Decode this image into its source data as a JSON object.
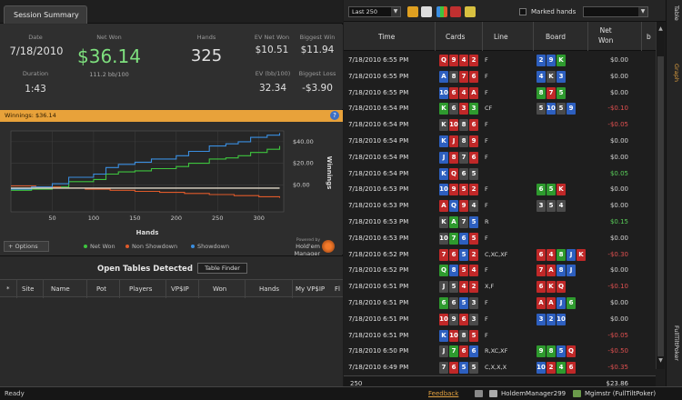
{
  "left": {
    "tab": "Session Summary",
    "stats": {
      "date_label": "Date",
      "date": "7/18/2010",
      "netwon_label": "Net Won",
      "netwon": "$36.14",
      "netwon_sub": "111.2 bb/100",
      "hands_label": "Hands",
      "hands": "325",
      "ev_netwon_label": "EV Net Won",
      "ev_netwon": "$10.51",
      "biggest_win_label": "Biggest Win",
      "biggest_win": "$11.94",
      "duration_label": "Duration",
      "duration": "1:43",
      "ev_bb_label": "EV (bb/100)",
      "ev_bb": "32.34",
      "biggest_loss_label": "Biggest Loss",
      "biggest_loss": "-$3.90"
    },
    "winnings_bar": "Winnings: $36.14",
    "options_label": "+ Options",
    "legend": [
      {
        "label": "Net Won",
        "color": "#3ec43e"
      },
      {
        "label": "Non Showdown",
        "color": "#e05a2a"
      },
      {
        "label": "Showdown",
        "color": "#3a8ee0"
      }
    ],
    "powered_by": "Powered by",
    "brand": "Hold'em Manager",
    "open_tables": {
      "title": "Open Tables Detected",
      "finder_button": "Table Finder",
      "columns": [
        "Site",
        "Name",
        "Pot",
        "Players",
        "VP$IP",
        "Won",
        "Hands",
        "My VP$IP",
        "Fl"
      ]
    }
  },
  "chart_data": {
    "type": "line",
    "xlabel": "Hands",
    "ylabel": "Winnings",
    "xticks": [
      "50",
      "100",
      "150",
      "200",
      "250",
      "300"
    ],
    "yticks": [
      "$40.00",
      "$20.00",
      "$0.00"
    ],
    "xlim": [
      0,
      330
    ],
    "ylim": [
      -25,
      50
    ],
    "series": [
      {
        "name": "Net Won",
        "color": "#3ec43e",
        "x": [
          0,
          25,
          50,
          70,
          100,
          115,
          130,
          150,
          170,
          200,
          215,
          240,
          260,
          275,
          290,
          310,
          325
        ],
        "y": [
          -5,
          -4,
          -2,
          3,
          5,
          10,
          12,
          13,
          15,
          17,
          20,
          24,
          25,
          27,
          30,
          33,
          36
        ]
      },
      {
        "name": "Non Showdown",
        "color": "#e05a2a",
        "x": [
          0,
          30,
          60,
          90,
          120,
          150,
          180,
          210,
          240,
          270,
          300,
          325
        ],
        "y": [
          -1,
          -2,
          -3,
          -4,
          -5,
          -6,
          -7,
          -8,
          -9,
          -10,
          -11,
          -12
        ]
      },
      {
        "name": "Showdown",
        "color": "#3a8ee0",
        "x": [
          0,
          25,
          50,
          70,
          100,
          115,
          130,
          150,
          170,
          200,
          215,
          240,
          260,
          275,
          290,
          310,
          325
        ],
        "y": [
          -4,
          -2,
          1,
          7,
          10,
          16,
          19,
          21,
          24,
          27,
          31,
          36,
          38,
          40,
          44,
          46,
          48
        ]
      },
      {
        "name": "EV",
        "color": "#e0d8c8",
        "x": [
          0,
          325
        ],
        "y": [
          -3,
          -3
        ]
      }
    ]
  },
  "right": {
    "last_select": "Last 250",
    "marked_hands": "Marked hands",
    "columns": [
      "Time",
      "Cards",
      "Line",
      "Board",
      "Net\nWon",
      "b"
    ],
    "rows": [
      {
        "time": "7/18/2010 6:55 PM",
        "cards": [
          [
            "Q",
            "h"
          ],
          [
            "9",
            "h"
          ],
          [
            "4",
            "h"
          ],
          [
            "2",
            "h"
          ]
        ],
        "line": "F",
        "board": [
          [
            "2",
            "d"
          ],
          [
            "9",
            "d"
          ],
          [
            "K",
            "c"
          ]
        ],
        "won": "$0.00"
      },
      {
        "time": "7/18/2010 6:55 PM",
        "cards": [
          [
            "A",
            "d"
          ],
          [
            "8",
            "s"
          ],
          [
            "7",
            "h"
          ],
          [
            "6",
            "h"
          ]
        ],
        "line": "F",
        "board": [
          [
            "4",
            "d"
          ],
          [
            "K",
            "s"
          ],
          [
            "3",
            "d"
          ]
        ],
        "won": "$0.00"
      },
      {
        "time": "7/18/2010 6:55 PM",
        "cards": [
          [
            "10",
            "d"
          ],
          [
            "6",
            "h"
          ],
          [
            "4",
            "h"
          ],
          [
            "A",
            "h"
          ]
        ],
        "line": "F",
        "board": [
          [
            "8",
            "c"
          ],
          [
            "7",
            "h"
          ],
          [
            "5",
            "c"
          ]
        ],
        "won": "$0.00"
      },
      {
        "time": "7/18/2010 6:54 PM",
        "cards": [
          [
            "K",
            "c"
          ],
          [
            "6",
            "s"
          ],
          [
            "3",
            "h"
          ],
          [
            "3",
            "c"
          ]
        ],
        "line": "CF",
        "board": [
          [
            "5",
            "s"
          ],
          [
            "10",
            "d"
          ],
          [
            "5",
            "s"
          ],
          [
            "9",
            "d"
          ]
        ],
        "won": "-$0.10"
      },
      {
        "time": "7/18/2010 6:54 PM",
        "cards": [
          [
            "K",
            "s"
          ],
          [
            "10",
            "h"
          ],
          [
            "8",
            "s"
          ],
          [
            "6",
            "h"
          ]
        ],
        "line": "F",
        "board": [],
        "won": "-$0.05"
      },
      {
        "time": "7/18/2010 6:54 PM",
        "cards": [
          [
            "K",
            "d"
          ],
          [
            "J",
            "h"
          ],
          [
            "8",
            "s"
          ],
          [
            "9",
            "h"
          ]
        ],
        "line": "F",
        "board": [],
        "won": "$0.00"
      },
      {
        "time": "7/18/2010 6:54 PM",
        "cards": [
          [
            "J",
            "d"
          ],
          [
            "8",
            "h"
          ],
          [
            "7",
            "s"
          ],
          [
            "6",
            "h"
          ]
        ],
        "line": "F",
        "board": [],
        "won": "$0.00"
      },
      {
        "time": "7/18/2010 6:54 PM",
        "cards": [
          [
            "K",
            "d"
          ],
          [
            "Q",
            "h"
          ],
          [
            "6",
            "s"
          ],
          [
            "5",
            "s"
          ]
        ],
        "line": "",
        "board": [],
        "won": "$0.05"
      },
      {
        "time": "7/18/2010 6:53 PM",
        "cards": [
          [
            "10",
            "d"
          ],
          [
            "9",
            "h"
          ],
          [
            "5",
            "h"
          ],
          [
            "2",
            "h"
          ]
        ],
        "line": "F",
        "board": [
          [
            "6",
            "c"
          ],
          [
            "5",
            "c"
          ],
          [
            "K",
            "h"
          ]
        ],
        "won": "$0.00"
      },
      {
        "time": "7/18/2010 6:53 PM",
        "cards": [
          [
            "A",
            "h"
          ],
          [
            "Q",
            "d"
          ],
          [
            "9",
            "h"
          ],
          [
            "4",
            "s"
          ]
        ],
        "line": "F",
        "board": [
          [
            "3",
            "s"
          ],
          [
            "5",
            "s"
          ],
          [
            "4",
            "s"
          ]
        ],
        "won": "$0.00"
      },
      {
        "time": "7/18/2010 6:53 PM",
        "cards": [
          [
            "K",
            "s"
          ],
          [
            "A",
            "c"
          ],
          [
            "7",
            "s"
          ],
          [
            "5",
            "d"
          ]
        ],
        "line": "R",
        "board": [],
        "won": "$0.15"
      },
      {
        "time": "7/18/2010 6:53 PM",
        "cards": [
          [
            "10",
            "s"
          ],
          [
            "7",
            "c"
          ],
          [
            "6",
            "d"
          ],
          [
            "5",
            "h"
          ]
        ],
        "line": "F",
        "board": [],
        "won": "$0.00"
      },
      {
        "time": "7/18/2010 6:52 PM",
        "cards": [
          [
            "7",
            "h"
          ],
          [
            "6",
            "h"
          ],
          [
            "5",
            "d"
          ],
          [
            "2",
            "h"
          ]
        ],
        "line": "C,XC,XF",
        "board": [
          [
            "6",
            "h"
          ],
          [
            "4",
            "h"
          ],
          [
            "8",
            "c"
          ],
          [
            "J",
            "d"
          ],
          [
            "K",
            "h"
          ]
        ],
        "won": "-$0.30"
      },
      {
        "time": "7/18/2010 6:52 PM",
        "cards": [
          [
            "Q",
            "c"
          ],
          [
            "8",
            "d"
          ],
          [
            "5",
            "h"
          ],
          [
            "4",
            "h"
          ]
        ],
        "line": "F",
        "board": [
          [
            "7",
            "h"
          ],
          [
            "A",
            "h"
          ],
          [
            "8",
            "d"
          ],
          [
            "J",
            "d"
          ]
        ],
        "won": "$0.00"
      },
      {
        "time": "7/18/2010 6:51 PM",
        "cards": [
          [
            "J",
            "s"
          ],
          [
            "5",
            "s"
          ],
          [
            "4",
            "h"
          ],
          [
            "2",
            "h"
          ]
        ],
        "line": "X,F",
        "board": [
          [
            "6",
            "h"
          ],
          [
            "K",
            "h"
          ],
          [
            "Q",
            "h"
          ]
        ],
        "won": "-$0.10"
      },
      {
        "time": "7/18/2010 6:51 PM",
        "cards": [
          [
            "6",
            "c"
          ],
          [
            "6",
            "s"
          ],
          [
            "5",
            "d"
          ],
          [
            "3",
            "s"
          ]
        ],
        "line": "F",
        "board": [
          [
            "A",
            "h"
          ],
          [
            "A",
            "h"
          ],
          [
            "J",
            "d"
          ],
          [
            "6",
            "c"
          ]
        ],
        "won": "$0.00"
      },
      {
        "time": "7/18/2010 6:51 PM",
        "cards": [
          [
            "10",
            "h"
          ],
          [
            "9",
            "s"
          ],
          [
            "6",
            "h"
          ],
          [
            "3",
            "s"
          ]
        ],
        "line": "F",
        "board": [
          [
            "3",
            "d"
          ],
          [
            "2",
            "d"
          ],
          [
            "10",
            "d"
          ]
        ],
        "won": "$0.00"
      },
      {
        "time": "7/18/2010 6:51 PM",
        "cards": [
          [
            "K",
            "d"
          ],
          [
            "10",
            "h"
          ],
          [
            "8",
            "s"
          ],
          [
            "5",
            "h"
          ]
        ],
        "line": "F",
        "board": [],
        "won": "-$0.05"
      },
      {
        "time": "7/18/2010 6:50 PM",
        "cards": [
          [
            "J",
            "s"
          ],
          [
            "7",
            "c"
          ],
          [
            "6",
            "h"
          ],
          [
            "6",
            "d"
          ]
        ],
        "line": "R,XC,XF",
        "board": [
          [
            "9",
            "c"
          ],
          [
            "8",
            "c"
          ],
          [
            "5",
            "d"
          ],
          [
            "Q",
            "h"
          ]
        ],
        "won": "-$0.50"
      },
      {
        "time": "7/18/2010 6:49 PM",
        "cards": [
          [
            "7",
            "s"
          ],
          [
            "6",
            "h"
          ],
          [
            "5",
            "d"
          ],
          [
            "5",
            "s"
          ]
        ],
        "line": "C,X,X,X",
        "board": [
          [
            "10",
            "d"
          ],
          [
            "2",
            "h"
          ],
          [
            "4",
            "c"
          ],
          [
            "6",
            "h"
          ]
        ],
        "won": "-$0.35"
      }
    ],
    "footer_count": "250",
    "footer_total": "$23.86",
    "side_tabs": [
      "Table",
      "Graph",
      "FullTiltPoker"
    ]
  },
  "status": {
    "ready": "Ready",
    "feedback": "Feedback",
    "db": "HoldemManager299",
    "player": "Mgimstr (FullTiltPoker)"
  }
}
